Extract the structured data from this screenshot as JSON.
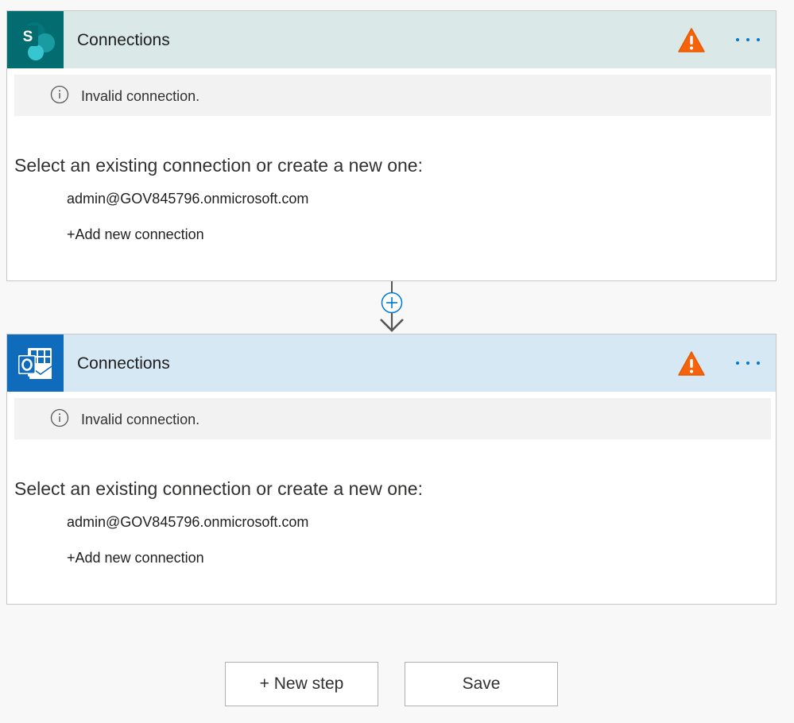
{
  "steps": [
    {
      "app_icon": "sharepoint-icon",
      "header_color": "#dae8e8",
      "tile_color": "#036c70",
      "title": "Connections",
      "warning_icon": "warning-icon",
      "more_icon": "ellipsis-icon",
      "info_message": "Invalid connection.",
      "prompt": "Select an existing connection or create a new one:",
      "existing_connection": "admin@GOV845796.onmicrosoft.com",
      "add_connection": "+Add new connection"
    },
    {
      "app_icon": "outlook-icon",
      "header_color": "#d7e8f5",
      "tile_color": "#0f6cbd",
      "title": "Connections",
      "warning_icon": "warning-icon",
      "more_icon": "ellipsis-icon",
      "info_message": "Invalid connection.",
      "prompt": "Select an existing connection or create a new one:",
      "existing_connection": "admin@GOV845796.onmicrosoft.com",
      "add_connection": "+Add new connection"
    }
  ],
  "connector": {
    "add_icon": "plus-circle-icon",
    "arrow_icon": "arrow-down-icon"
  },
  "footer": {
    "new_step_label": "+ New step",
    "save_label": "Save"
  },
  "colors": {
    "warning": "#f7630c",
    "accent": "#0078d4"
  }
}
